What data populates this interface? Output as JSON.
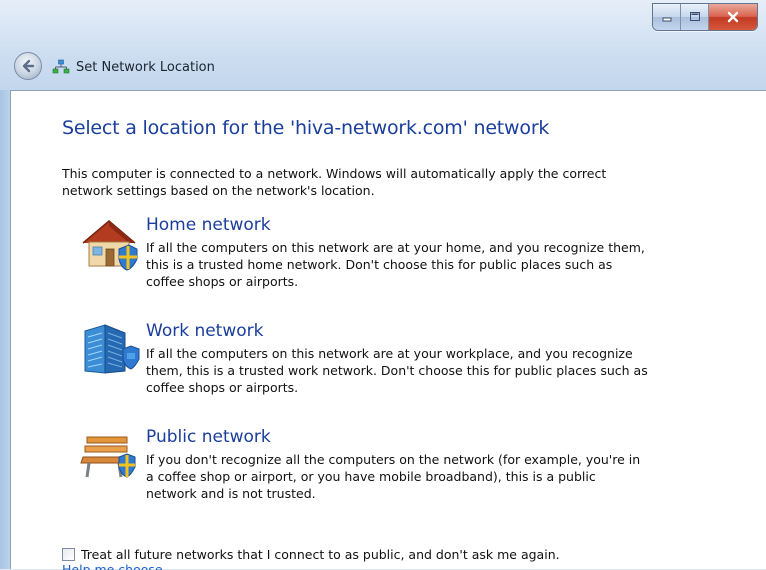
{
  "window": {
    "title": "Set Network Location",
    "caption_buttons": {
      "minimize": "minimize",
      "maximize": "maximize",
      "close": "close"
    }
  },
  "content": {
    "heading": "Select a location for the 'hiva-network.com' network",
    "intro": "This computer is connected to a network. Windows will automatically apply the correct\nnetwork settings based on the network's location.",
    "options": [
      {
        "title": "Home network",
        "description": "If all the computers on this network are at your home, and you recognize them,\nthis is a trusted home network.  Don't choose this for public places such as\ncoffee shops or airports.",
        "icon": "home-network-icon"
      },
      {
        "title": "Work network",
        "description": "If all the computers on this network are at your workplace, and you recognize\nthem, this is a trusted work network.  Don't choose this for public places such as\ncoffee shops or airports.",
        "icon": "work-network-icon"
      },
      {
        "title": "Public network",
        "description": "If you don't recognize all the computers on the network (for example, you're in\na coffee shop or airport, or you have mobile broadband), this is a public\nnetwork and is not trusted.",
        "icon": "public-network-icon"
      }
    ],
    "checkbox_label": "Treat all future networks that I connect to as public, and don't ask me again.",
    "checkbox_checked": false,
    "help_link": "Help me choose"
  },
  "colors": {
    "heading": "#1a3e9c",
    "link": "#1a5fc4",
    "close_button": "#c23a22"
  }
}
